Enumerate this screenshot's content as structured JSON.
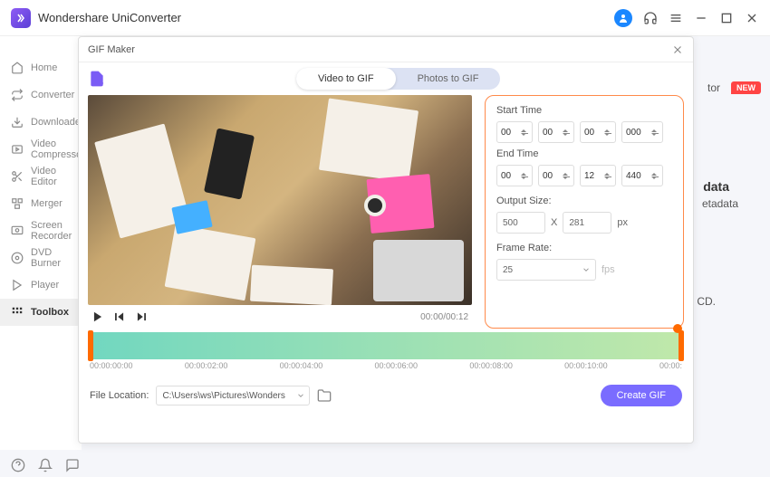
{
  "app": {
    "title": "Wondershare UniConverter"
  },
  "sidebar": {
    "items": [
      {
        "label": "Home"
      },
      {
        "label": "Converter"
      },
      {
        "label": "Downloader"
      },
      {
        "label": "Video Compressor"
      },
      {
        "label": "Video Editor"
      },
      {
        "label": "Merger"
      },
      {
        "label": "Screen Recorder"
      },
      {
        "label": "DVD Burner"
      },
      {
        "label": "Player"
      },
      {
        "label": "Toolbox"
      }
    ]
  },
  "badge": {
    "new": "NEW"
  },
  "bg": {
    "tor": "tor",
    "data": "data",
    "etadata": "etadata",
    "cd": "CD."
  },
  "modal": {
    "title": "GIF Maker",
    "tabs": {
      "video": "Video to GIF",
      "photos": "Photos to GIF"
    },
    "time_display": "00:00/00:12",
    "settings": {
      "start_label": "Start Time",
      "end_label": "End Time",
      "start": {
        "hh": "00",
        "mm": "00",
        "ss": "00",
        "ms": "000"
      },
      "end": {
        "hh": "00",
        "mm": "00",
        "ss": "12",
        "ms": "440"
      },
      "output_label": "Output Size:",
      "width": "500",
      "x": "X",
      "height": "281",
      "px": "px",
      "framerate_label": "Frame Rate:",
      "framerate": "25",
      "fps": "fps"
    },
    "ticks": [
      "00:00:00:00",
      "00:00:02:00",
      "00:00:04:00",
      "00:00:06:00",
      "00:00:08:00",
      "00:00:10:00",
      "00:00:"
    ],
    "footer": {
      "file_label": "File Location:",
      "file_path": "C:\\Users\\ws\\Pictures\\Wonders",
      "create": "Create GIF"
    }
  }
}
